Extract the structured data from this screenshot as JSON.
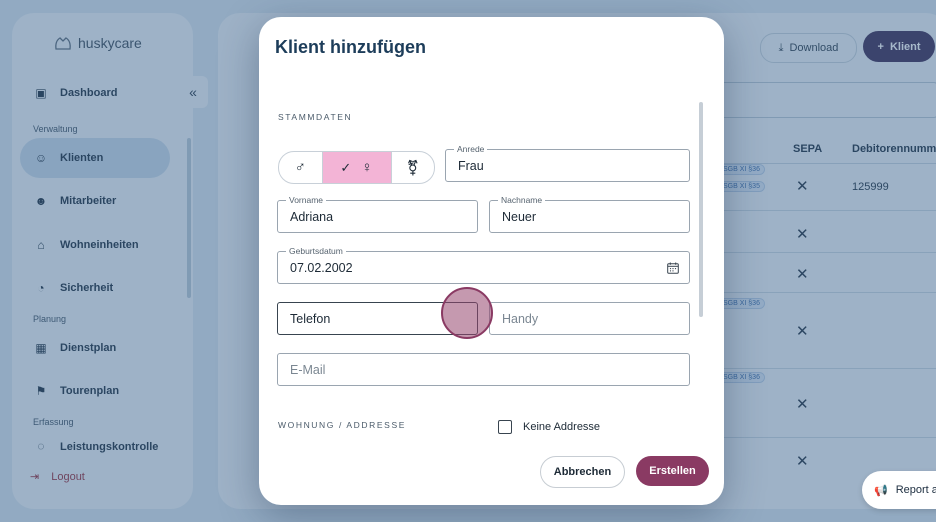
{
  "app": {
    "brand": "huskycare"
  },
  "sidebar": {
    "collapse_glyph": "«",
    "sections": {
      "verwaltung": "Verwaltung",
      "planung": "Planung",
      "erfassung": "Erfassung"
    },
    "items": [
      {
        "label": "Dashboard",
        "icon": "dashboard-icon"
      },
      {
        "label": "Klienten",
        "icon": "clients-icon"
      },
      {
        "label": "Mitarbeiter",
        "icon": "staff-icon"
      },
      {
        "label": "Wohneinheiten",
        "icon": "home-icon"
      },
      {
        "label": "Sicherheit",
        "icon": "security-icon"
      },
      {
        "label": "Dienstplan",
        "icon": "calendar-icon"
      },
      {
        "label": "Tourenplan",
        "icon": "flag-icon"
      },
      {
        "label": "Leistungskontrolle",
        "icon": "check-icon"
      }
    ],
    "logout": "Logout"
  },
  "header": {
    "download_label": "Download",
    "add_client_label": "Klient"
  },
  "table": {
    "headers": {
      "sepa": "SEPA",
      "debitor": "Debitorennumm"
    },
    "first_debitor": "125999",
    "pills": [
      "SGB XI §36",
      "SGB XI §35",
      "SGB XI §36",
      "SGB XI §36"
    ],
    "x_glyph": "✕"
  },
  "report_button": "Report a",
  "modal": {
    "title": "Klient hinzufügen",
    "section_stammdaten": "STAMMDATEN",
    "section_wohnung": "WOHNUNG / ADDRESSE",
    "gender": {
      "male": "♂",
      "female": "♀",
      "diverse": "⚧",
      "check": "✓",
      "selected": "female"
    },
    "anrede": {
      "label": "Anrede",
      "value": "Frau"
    },
    "vorname": {
      "label": "Vorname",
      "value": "Adriana"
    },
    "nachname": {
      "label": "Nachname",
      "value": "Neuer"
    },
    "geburtsdatum": {
      "label": "Geburtsdatum",
      "value": "07.02.2002"
    },
    "telefon": {
      "placeholder": "Telefon"
    },
    "handy": {
      "placeholder": "Handy"
    },
    "email": {
      "placeholder": "E-Mail"
    },
    "no_address_label": "Keine Addresse",
    "cancel_label": "Abbrechen",
    "create_label": "Erstellen"
  },
  "colors": {
    "accent": "#8a3a63",
    "selected_gender": "#f3b4d6",
    "primary_dark": "#3b2a55",
    "title": "#1d3d5a"
  }
}
